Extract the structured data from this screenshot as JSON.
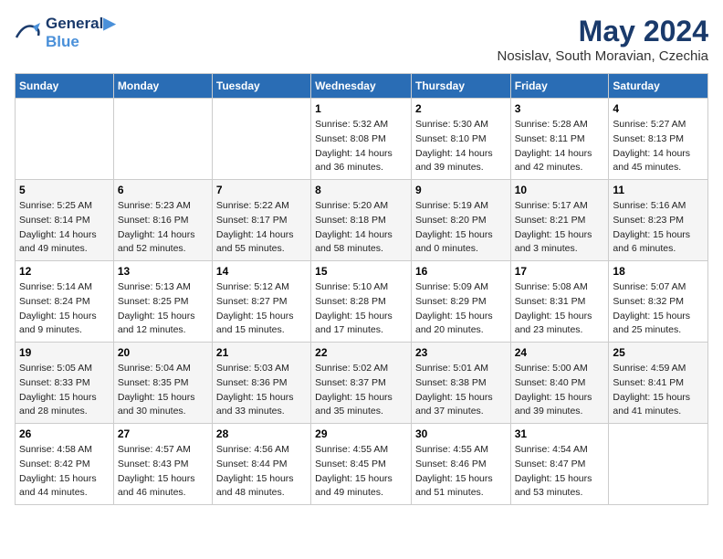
{
  "header": {
    "logo_line1": "General",
    "logo_line2": "Blue",
    "month_year": "May 2024",
    "location": "Nosislav, South Moravian, Czechia"
  },
  "weekdays": [
    "Sunday",
    "Monday",
    "Tuesday",
    "Wednesday",
    "Thursday",
    "Friday",
    "Saturday"
  ],
  "weeks": [
    [
      {
        "day": "",
        "info": ""
      },
      {
        "day": "",
        "info": ""
      },
      {
        "day": "",
        "info": ""
      },
      {
        "day": "1",
        "info": "Sunrise: 5:32 AM\nSunset: 8:08 PM\nDaylight: 14 hours\nand 36 minutes."
      },
      {
        "day": "2",
        "info": "Sunrise: 5:30 AM\nSunset: 8:10 PM\nDaylight: 14 hours\nand 39 minutes."
      },
      {
        "day": "3",
        "info": "Sunrise: 5:28 AM\nSunset: 8:11 PM\nDaylight: 14 hours\nand 42 minutes."
      },
      {
        "day": "4",
        "info": "Sunrise: 5:27 AM\nSunset: 8:13 PM\nDaylight: 14 hours\nand 45 minutes."
      }
    ],
    [
      {
        "day": "5",
        "info": "Sunrise: 5:25 AM\nSunset: 8:14 PM\nDaylight: 14 hours\nand 49 minutes."
      },
      {
        "day": "6",
        "info": "Sunrise: 5:23 AM\nSunset: 8:16 PM\nDaylight: 14 hours\nand 52 minutes."
      },
      {
        "day": "7",
        "info": "Sunrise: 5:22 AM\nSunset: 8:17 PM\nDaylight: 14 hours\nand 55 minutes."
      },
      {
        "day": "8",
        "info": "Sunrise: 5:20 AM\nSunset: 8:18 PM\nDaylight: 14 hours\nand 58 minutes."
      },
      {
        "day": "9",
        "info": "Sunrise: 5:19 AM\nSunset: 8:20 PM\nDaylight: 15 hours\nand 0 minutes."
      },
      {
        "day": "10",
        "info": "Sunrise: 5:17 AM\nSunset: 8:21 PM\nDaylight: 15 hours\nand 3 minutes."
      },
      {
        "day": "11",
        "info": "Sunrise: 5:16 AM\nSunset: 8:23 PM\nDaylight: 15 hours\nand 6 minutes."
      }
    ],
    [
      {
        "day": "12",
        "info": "Sunrise: 5:14 AM\nSunset: 8:24 PM\nDaylight: 15 hours\nand 9 minutes."
      },
      {
        "day": "13",
        "info": "Sunrise: 5:13 AM\nSunset: 8:25 PM\nDaylight: 15 hours\nand 12 minutes."
      },
      {
        "day": "14",
        "info": "Sunrise: 5:12 AM\nSunset: 8:27 PM\nDaylight: 15 hours\nand 15 minutes."
      },
      {
        "day": "15",
        "info": "Sunrise: 5:10 AM\nSunset: 8:28 PM\nDaylight: 15 hours\nand 17 minutes."
      },
      {
        "day": "16",
        "info": "Sunrise: 5:09 AM\nSunset: 8:29 PM\nDaylight: 15 hours\nand 20 minutes."
      },
      {
        "day": "17",
        "info": "Sunrise: 5:08 AM\nSunset: 8:31 PM\nDaylight: 15 hours\nand 23 minutes."
      },
      {
        "day": "18",
        "info": "Sunrise: 5:07 AM\nSunset: 8:32 PM\nDaylight: 15 hours\nand 25 minutes."
      }
    ],
    [
      {
        "day": "19",
        "info": "Sunrise: 5:05 AM\nSunset: 8:33 PM\nDaylight: 15 hours\nand 28 minutes."
      },
      {
        "day": "20",
        "info": "Sunrise: 5:04 AM\nSunset: 8:35 PM\nDaylight: 15 hours\nand 30 minutes."
      },
      {
        "day": "21",
        "info": "Sunrise: 5:03 AM\nSunset: 8:36 PM\nDaylight: 15 hours\nand 33 minutes."
      },
      {
        "day": "22",
        "info": "Sunrise: 5:02 AM\nSunset: 8:37 PM\nDaylight: 15 hours\nand 35 minutes."
      },
      {
        "day": "23",
        "info": "Sunrise: 5:01 AM\nSunset: 8:38 PM\nDaylight: 15 hours\nand 37 minutes."
      },
      {
        "day": "24",
        "info": "Sunrise: 5:00 AM\nSunset: 8:40 PM\nDaylight: 15 hours\nand 39 minutes."
      },
      {
        "day": "25",
        "info": "Sunrise: 4:59 AM\nSunset: 8:41 PM\nDaylight: 15 hours\nand 41 minutes."
      }
    ],
    [
      {
        "day": "26",
        "info": "Sunrise: 4:58 AM\nSunset: 8:42 PM\nDaylight: 15 hours\nand 44 minutes."
      },
      {
        "day": "27",
        "info": "Sunrise: 4:57 AM\nSunset: 8:43 PM\nDaylight: 15 hours\nand 46 minutes."
      },
      {
        "day": "28",
        "info": "Sunrise: 4:56 AM\nSunset: 8:44 PM\nDaylight: 15 hours\nand 48 minutes."
      },
      {
        "day": "29",
        "info": "Sunrise: 4:55 AM\nSunset: 8:45 PM\nDaylight: 15 hours\nand 49 minutes."
      },
      {
        "day": "30",
        "info": "Sunrise: 4:55 AM\nSunset: 8:46 PM\nDaylight: 15 hours\nand 51 minutes."
      },
      {
        "day": "31",
        "info": "Sunrise: 4:54 AM\nSunset: 8:47 PM\nDaylight: 15 hours\nand 53 minutes."
      },
      {
        "day": "",
        "info": ""
      }
    ]
  ]
}
